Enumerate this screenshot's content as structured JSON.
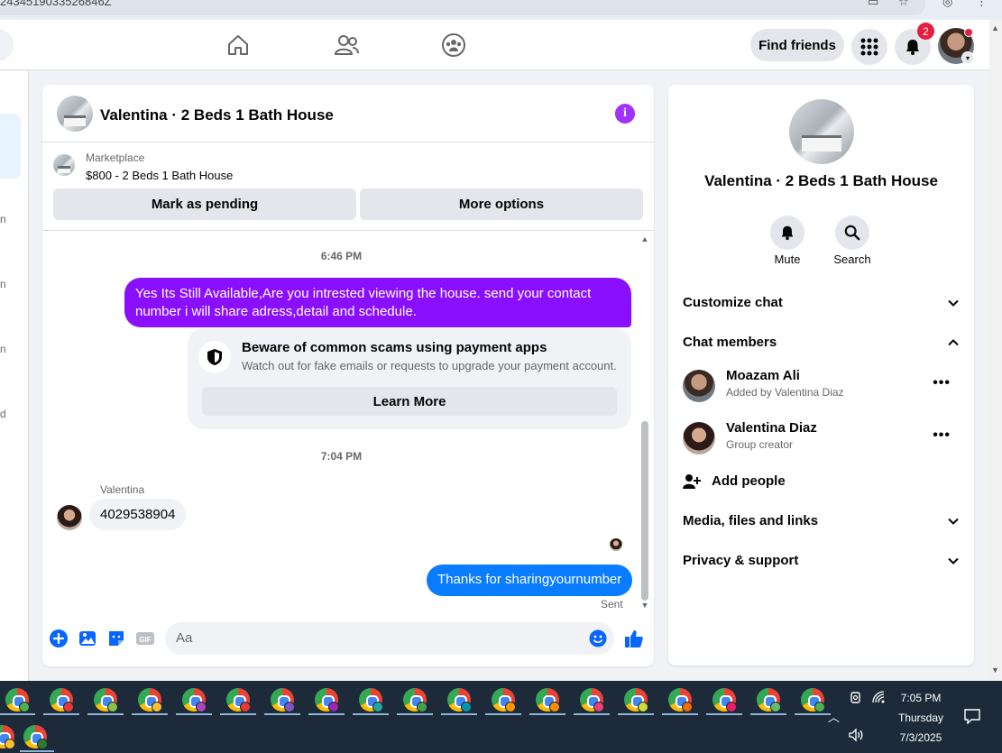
{
  "browser": {
    "url_fragment": "2434519033526846Z"
  },
  "header": {
    "find_friends_label": "Find friends",
    "notification_count": "2"
  },
  "chat": {
    "title": "Valentina · 2 Beds 1 Bath House",
    "marketplace": {
      "label": "Marketplace",
      "listing": "$800 - 2 Beds 1 Bath House",
      "mark_pending_label": "Mark as pending",
      "more_options_label": "More options"
    },
    "timestamp_1": "6:46 PM",
    "outgoing_message_1": "Yes Its Still Available,Are you intrested viewing the house. send your contact number i will share adress,detail and schedule.",
    "scam_notice": {
      "title": "Beware of common scams using payment apps",
      "description": "Watch out for fake emails or requests to upgrade your payment account.",
      "learn_more_label": "Learn More"
    },
    "timestamp_2": "7:04 PM",
    "incoming_sender": "Valentina",
    "incoming_message": "4029538904",
    "outgoing_message_2": "Thanks for sharingyournumber",
    "sent_status": "Sent",
    "composer_placeholder": "Aa"
  },
  "info_panel": {
    "title": "Valentina · 2 Beds 1 Bath House",
    "mute_label": "Mute",
    "search_label": "Search",
    "sections": {
      "customize_chat": "Customize chat",
      "chat_members": "Chat members",
      "media_files_links": "Media, files and links",
      "privacy_support": "Privacy & support"
    },
    "members": [
      {
        "name": "Moazam Ali",
        "subtitle": "Added by Valentina Diaz"
      },
      {
        "name": "Valentina Diaz",
        "subtitle": "Group creator"
      }
    ],
    "add_people_label": "Add people"
  },
  "taskbar": {
    "time": "7:05 PM",
    "day": "Thursday",
    "date": "7/3/2025"
  },
  "colors": {
    "messenger_purple": "#8a0fff",
    "messenger_blue": "#0a7cff",
    "facebook_blue": "#0866ff",
    "badge_red": "#e41e3f"
  }
}
